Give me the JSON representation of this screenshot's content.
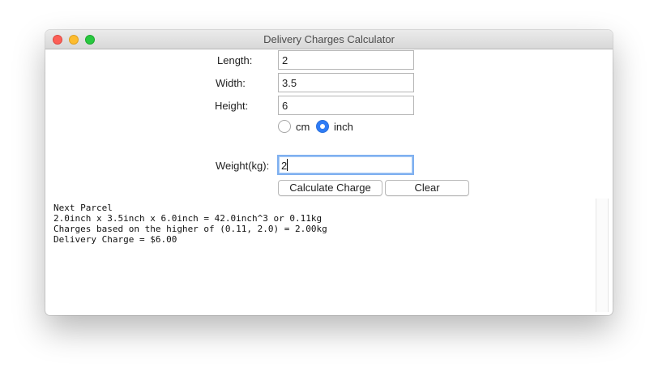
{
  "window": {
    "title": "Delivery Charges Calculator"
  },
  "form": {
    "length_label": "Length:",
    "length_value": "2",
    "width_label": "Width:",
    "width_value": "3.5",
    "height_label": "Height:",
    "height_value": "6",
    "unit_options": [
      "cm",
      "inch"
    ],
    "unit_selected": "inch",
    "weight_label": "Weight(kg):",
    "weight_value": "2"
  },
  "buttons": {
    "calculate": "Calculate Charge",
    "clear": "Clear"
  },
  "output": {
    "lines": [
      "Next Parcel",
      "2.0inch x 3.5inch x 6.0inch = 42.0inch^3 or 0.11kg",
      "Charges based on the higher of (0.11, 2.0) = 2.00kg",
      "Delivery Charge = $6.00"
    ]
  },
  "colors": {
    "close": "#fc5f57",
    "minimize": "#fdbc2e",
    "maximize": "#28c840",
    "radio_selected": "#2e7cf6",
    "focus_ring": "#7fb0f0"
  }
}
